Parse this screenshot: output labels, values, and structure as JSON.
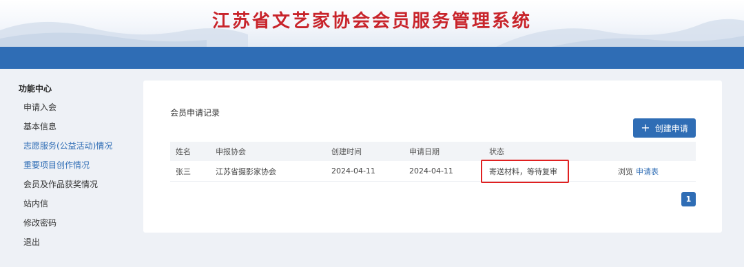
{
  "header": {
    "title": "江苏省文艺家协会会员服务管理系统"
  },
  "sidebar": {
    "title": "功能中心",
    "items": [
      {
        "label": "申请入会"
      },
      {
        "label": "基本信息"
      },
      {
        "label": "志愿服务(公益活动)情况"
      },
      {
        "label": "重要项目创作情况"
      },
      {
        "label": "会员及作品获奖情况"
      },
      {
        "label": "站内信"
      },
      {
        "label": "修改密码"
      },
      {
        "label": "退出"
      }
    ]
  },
  "main": {
    "title": "会员申请记录",
    "create_button": {
      "icon": "plus-icon",
      "label": "创建申请"
    },
    "table": {
      "headers": [
        "姓名",
        "申报协会",
        "创建时间",
        "申请日期",
        "状态",
        ""
      ],
      "rows": [
        {
          "name": "张三",
          "association": "江苏省摄影家协会",
          "created": "2024-04-11",
          "applied": "2024-04-11",
          "status": "寄送材料，等待复审",
          "action_view": "浏览",
          "action_form": "申请表"
        }
      ]
    },
    "pagination": {
      "current": "1"
    }
  },
  "colors": {
    "brand_blue": "#2f6db5",
    "title_red": "#c8242b",
    "highlight_border": "#e02020",
    "sidebar_link": "#2f6db5"
  }
}
